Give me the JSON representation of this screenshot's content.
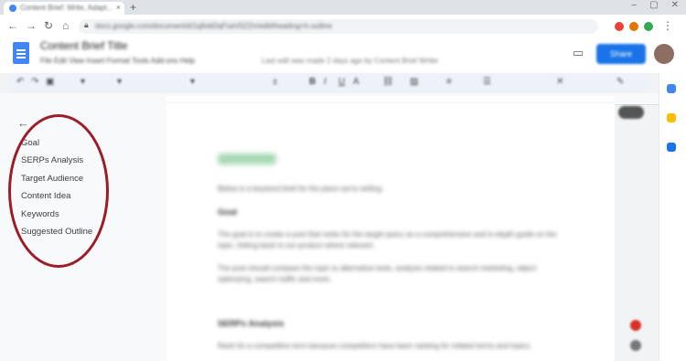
{
  "browser": {
    "tab_title": "Content Brief: Write, Adapt...",
    "url": "docs.google.com/document/d/1q8vbDqFsaV0ZZn/edit#heading=h.outline"
  },
  "docs": {
    "title": "Content Brief Title",
    "menu": "File  Edit  View  Insert  Format  Tools  Add-ons  Help",
    "status": "Last edit was made 2 days ago by Content Brief Writer",
    "share_label": "Share"
  },
  "outline": {
    "items": [
      {
        "label": "Goal"
      },
      {
        "label": "SERPs Analysis"
      },
      {
        "label": "Target Audience"
      },
      {
        "label": "Content Idea"
      },
      {
        "label": "Keywords"
      },
      {
        "label": "Suggested Outline"
      }
    ]
  },
  "document": {
    "intro": "Below is a keyword brief for the piece we're writing.",
    "goal_heading": "Goal",
    "goal_p1": "The goal is to create a post that ranks for the target query as a comprehensive and in-depth guide on the topic, linking back to our product where relevant.",
    "goal_p2": "The post should compare the topic to alternative tools, analysis related to search marketing, object optimizing, search traffic and more.",
    "serps_heading": "SERPs Analysis",
    "serps_p1": "Rank for a competitive term because competitors have been ranking for related terms and topics."
  },
  "colors": {
    "annotation": "#9c1c2a",
    "share": "#1a73e8",
    "highlight": "#a7d8b4"
  },
  "icons": [
    "back-arrow-icon",
    "comment-icon",
    "docs-logo-icon",
    "close-icon",
    "new-tab-icon"
  ]
}
